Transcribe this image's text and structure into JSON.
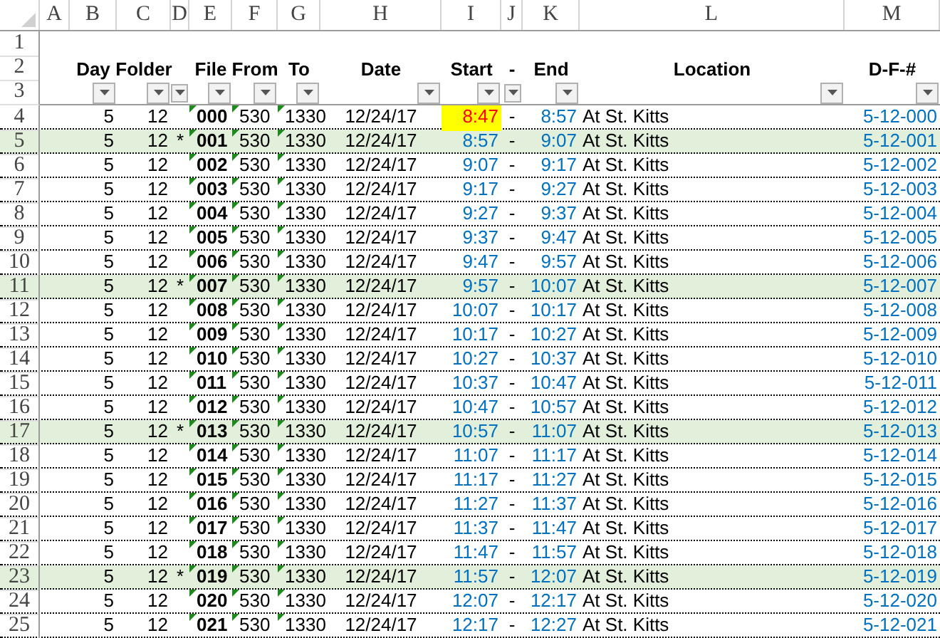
{
  "columns": [
    "A",
    "B",
    "C",
    "D",
    "E",
    "F",
    "G",
    "H",
    "I",
    "J",
    "K",
    "L",
    "M"
  ],
  "row_numbers": [
    "1",
    "2",
    "3",
    "4",
    "5",
    "6",
    "7",
    "8",
    "9",
    "10",
    "11",
    "12",
    "13",
    "14",
    "15",
    "16",
    "17",
    "18",
    "19",
    "20",
    "21",
    "22",
    "23",
    "24",
    "25"
  ],
  "headers": [
    {
      "label": "Day"
    },
    {
      "label": "Folder"
    },
    {
      "kind": "small"
    },
    {
      "label": "File"
    },
    {
      "label": "From"
    },
    {
      "label": "To"
    },
    {
      "label": "Date"
    },
    {
      "label": "Start"
    },
    {
      "label": "-",
      "kind": "small"
    },
    {
      "label": "End"
    },
    {
      "label": "Location"
    },
    {
      "label": "D-F-#"
    }
  ],
  "rows": [
    {
      "day": "5",
      "folder": "12",
      "file": "000",
      "from": "530",
      "to": "1330",
      "date": "12/24/17",
      "start": "8:47",
      "dash": "-",
      "end": "8:57",
      "location": "At St. Kitts",
      "dfn": "5-12-000",
      "highlighted": false,
      "start_flagged": true
    },
    {
      "day": "5",
      "folder": "12",
      "mark": "*",
      "file": "001",
      "from": "530",
      "to": "1330",
      "date": "12/24/17",
      "start": "8:57",
      "dash": "-",
      "end": "9:07",
      "location": "At St. Kitts",
      "dfn": "5-12-001",
      "highlighted": true,
      "start_flagged": false
    },
    {
      "day": "5",
      "folder": "12",
      "file": "002",
      "from": "530",
      "to": "1330",
      "date": "12/24/17",
      "start": "9:07",
      "dash": "-",
      "end": "9:17",
      "location": "At St. Kitts",
      "dfn": "5-12-002",
      "highlighted": false,
      "start_flagged": false
    },
    {
      "day": "5",
      "folder": "12",
      "file": "003",
      "from": "530",
      "to": "1330",
      "date": "12/24/17",
      "start": "9:17",
      "dash": "-",
      "end": "9:27",
      "location": "At St. Kitts",
      "dfn": "5-12-003",
      "highlighted": false,
      "start_flagged": false
    },
    {
      "day": "5",
      "folder": "12",
      "file": "004",
      "from": "530",
      "to": "1330",
      "date": "12/24/17",
      "start": "9:27",
      "dash": "-",
      "end": "9:37",
      "location": "At St. Kitts",
      "dfn": "5-12-004",
      "highlighted": false,
      "start_flagged": false
    },
    {
      "day": "5",
      "folder": "12",
      "file": "005",
      "from": "530",
      "to": "1330",
      "date": "12/24/17",
      "start": "9:37",
      "dash": "-",
      "end": "9:47",
      "location": "At St. Kitts",
      "dfn": "5-12-005",
      "highlighted": false,
      "start_flagged": false
    },
    {
      "day": "5",
      "folder": "12",
      "file": "006",
      "from": "530",
      "to": "1330",
      "date": "12/24/17",
      "start": "9:47",
      "dash": "-",
      "end": "9:57",
      "location": "At St. Kitts",
      "dfn": "5-12-006",
      "highlighted": false,
      "start_flagged": false
    },
    {
      "day": "5",
      "folder": "12",
      "mark": "*",
      "file": "007",
      "from": "530",
      "to": "1330",
      "date": "12/24/17",
      "start": "9:57",
      "dash": "-",
      "end": "10:07",
      "location": "At St. Kitts",
      "dfn": "5-12-007",
      "highlighted": true,
      "start_flagged": false
    },
    {
      "day": "5",
      "folder": "12",
      "file": "008",
      "from": "530",
      "to": "1330",
      "date": "12/24/17",
      "start": "10:07",
      "dash": "-",
      "end": "10:17",
      "location": "At St. Kitts",
      "dfn": "5-12-008",
      "highlighted": false,
      "start_flagged": false
    },
    {
      "day": "5",
      "folder": "12",
      "file": "009",
      "from": "530",
      "to": "1330",
      "date": "12/24/17",
      "start": "10:17",
      "dash": "-",
      "end": "10:27",
      "location": "At St. Kitts",
      "dfn": "5-12-009",
      "highlighted": false,
      "start_flagged": false
    },
    {
      "day": "5",
      "folder": "12",
      "file": "010",
      "from": "530",
      "to": "1330",
      "date": "12/24/17",
      "start": "10:27",
      "dash": "-",
      "end": "10:37",
      "location": "At St. Kitts",
      "dfn": "5-12-010",
      "highlighted": false,
      "start_flagged": false
    },
    {
      "day": "5",
      "folder": "12",
      "file": "011",
      "from": "530",
      "to": "1330",
      "date": "12/24/17",
      "start": "10:37",
      "dash": "-",
      "end": "10:47",
      "location": "At St. Kitts",
      "dfn": "5-12-011",
      "highlighted": false,
      "start_flagged": false
    },
    {
      "day": "5",
      "folder": "12",
      "file": "012",
      "from": "530",
      "to": "1330",
      "date": "12/24/17",
      "start": "10:47",
      "dash": "-",
      "end": "10:57",
      "location": "At St. Kitts",
      "dfn": "5-12-012",
      "highlighted": false,
      "start_flagged": false
    },
    {
      "day": "5",
      "folder": "12",
      "mark": "*",
      "file": "013",
      "from": "530",
      "to": "1330",
      "date": "12/24/17",
      "start": "10:57",
      "dash": "-",
      "end": "11:07",
      "location": "At St. Kitts",
      "dfn": "5-12-013",
      "highlighted": true,
      "start_flagged": false
    },
    {
      "day": "5",
      "folder": "12",
      "file": "014",
      "from": "530",
      "to": "1330",
      "date": "12/24/17",
      "start": "11:07",
      "dash": "-",
      "end": "11:17",
      "location": "At St. Kitts",
      "dfn": "5-12-014",
      "highlighted": false,
      "start_flagged": false
    },
    {
      "day": "5",
      "folder": "12",
      "file": "015",
      "from": "530",
      "to": "1330",
      "date": "12/24/17",
      "start": "11:17",
      "dash": "-",
      "end": "11:27",
      "location": "At St. Kitts",
      "dfn": "5-12-015",
      "highlighted": false,
      "start_flagged": false
    },
    {
      "day": "5",
      "folder": "12",
      "file": "016",
      "from": "530",
      "to": "1330",
      "date": "12/24/17",
      "start": "11:27",
      "dash": "-",
      "end": "11:37",
      "location": "At St. Kitts",
      "dfn": "5-12-016",
      "highlighted": false,
      "start_flagged": false
    },
    {
      "day": "5",
      "folder": "12",
      "file": "017",
      "from": "530",
      "to": "1330",
      "date": "12/24/17",
      "start": "11:37",
      "dash": "-",
      "end": "11:47",
      "location": "At St. Kitts",
      "dfn": "5-12-017",
      "highlighted": false,
      "start_flagged": false
    },
    {
      "day": "5",
      "folder": "12",
      "file": "018",
      "from": "530",
      "to": "1330",
      "date": "12/24/17",
      "start": "11:47",
      "dash": "-",
      "end": "11:57",
      "location": "At St. Kitts",
      "dfn": "5-12-018",
      "highlighted": false,
      "start_flagged": false
    },
    {
      "day": "5",
      "folder": "12",
      "mark": "*",
      "file": "019",
      "from": "530",
      "to": "1330",
      "date": "12/24/17",
      "start": "11:57",
      "dash": "-",
      "end": "12:07",
      "location": "At St. Kitts",
      "dfn": "5-12-019",
      "highlighted": true,
      "start_flagged": false
    },
    {
      "day": "5",
      "folder": "12",
      "file": "020",
      "from": "530",
      "to": "1330",
      "date": "12/24/17",
      "start": "12:07",
      "dash": "-",
      "end": "12:17",
      "location": "At St. Kitts",
      "dfn": "5-12-020",
      "highlighted": false,
      "start_flagged": false
    },
    {
      "day": "5",
      "folder": "12",
      "file": "021",
      "from": "530",
      "to": "1330",
      "date": "12/24/17",
      "start": "12:17",
      "dash": "-",
      "end": "12:27",
      "location": "At St. Kitts",
      "dfn": "5-12-021",
      "highlighted": false,
      "start_flagged": false
    }
  ]
}
